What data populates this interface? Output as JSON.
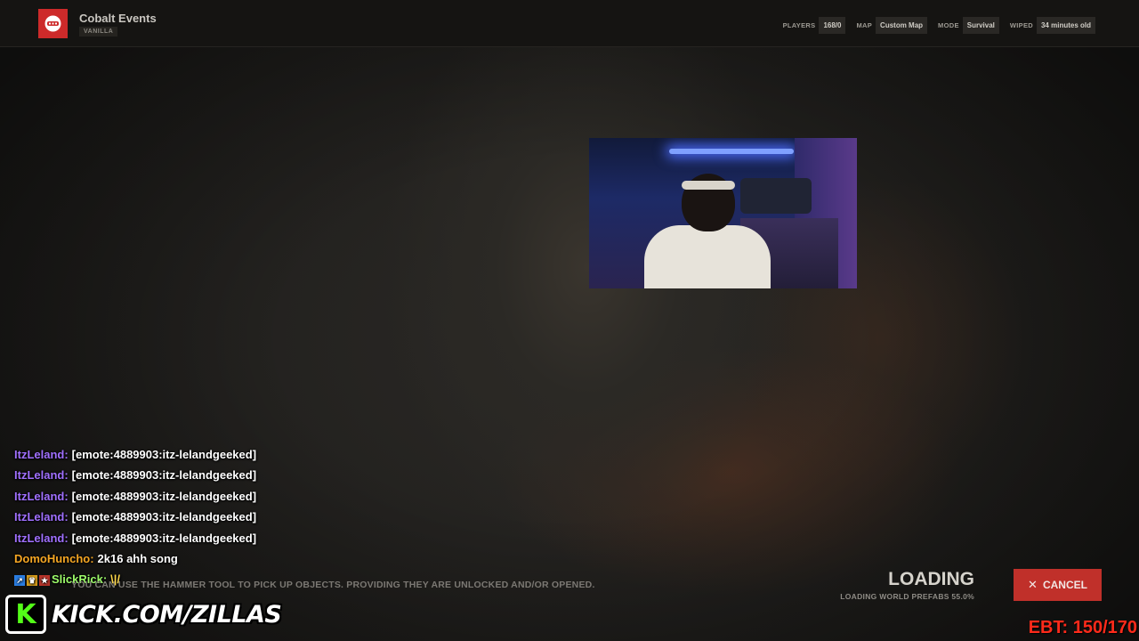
{
  "server": {
    "name": "Cobalt Events",
    "tag": "VANILLA",
    "accent": "#cd2a2a"
  },
  "stats": [
    {
      "label": "PLAYERS",
      "value": "168/0"
    },
    {
      "label": "MAP",
      "value": "Custom Map"
    },
    {
      "label": "MODE",
      "value": "Survival"
    },
    {
      "label": "WIPED",
      "value": "34 minutes old"
    }
  ],
  "chat": [
    {
      "user": "ItzLeland:",
      "color": "#a070ff",
      "message": "[emote:4889903:itz-lelandgeeked]"
    },
    {
      "user": "ItzLeland:",
      "color": "#a070ff",
      "message": "[emote:4889903:itz-lelandgeeked]"
    },
    {
      "user": "ItzLeland:",
      "color": "#a070ff",
      "message": "[emote:4889903:itz-lelandgeeked]"
    },
    {
      "user": "ItzLeland:",
      "color": "#a070ff",
      "message": "[emote:4889903:itz-lelandgeeked]"
    },
    {
      "user": "ItzLeland:",
      "color": "#a070ff",
      "message": "[emote:4889903:itz-lelandgeeked]"
    },
    {
      "user": "DomoHuncho:",
      "color": "#f5a623",
      "message": "2k16 ahh song"
    },
    {
      "user": "SlickRick:",
      "color": "#9dfc6a",
      "message": "\\|/"
    }
  ],
  "tip": "YOU CAN USE THE HAMMER TOOL TO PICK UP OBJECTS. PROVIDING THEY ARE UNLOCKED AND/OR OPENED.",
  "loading": {
    "title": "LOADING",
    "status": "LOADING WORLD PREFABS 55.0%",
    "progress_percent": 55.0
  },
  "cancel_label": "CANCEL",
  "overlay": {
    "kick_url": "KICK.COM/ZILLAS",
    "ebt": "EBT: 150/170"
  },
  "colors": {
    "cancel": "#c0302a",
    "kick_green": "#53fc18",
    "ebt_red": "#ff2a1a"
  }
}
